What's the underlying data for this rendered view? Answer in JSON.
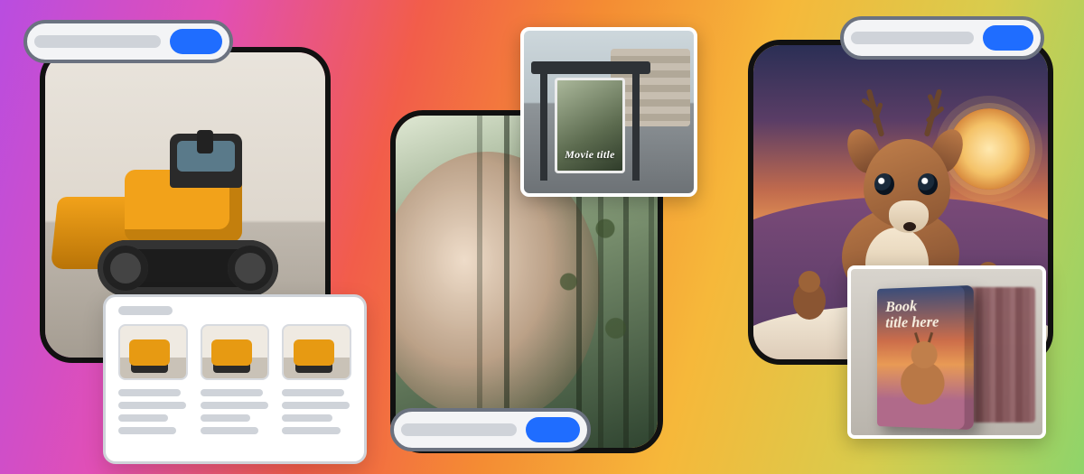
{
  "colors": {
    "pill_border": "#6b7280",
    "pill_bg": "#f3f4f6",
    "pill_field": "#cfd3d9",
    "action_blue": "#1f6dff",
    "frame_border": "#111111"
  },
  "left": {
    "frame_subject": "toy-bulldozer-render",
    "results": {
      "thumb_count": 3,
      "thumb_subject": "bulldozer-variant"
    }
  },
  "center": {
    "frame_subject": "forest-face-double-exposure",
    "poster": {
      "context": "bus-stop-poster-mockup",
      "title": "Movie title"
    }
  },
  "right": {
    "frame_subject": "stylized-deer-sunset",
    "book": {
      "context": "bookstore-cover-mockup",
      "title_line1": "Book",
      "title_line2": "title here"
    }
  }
}
